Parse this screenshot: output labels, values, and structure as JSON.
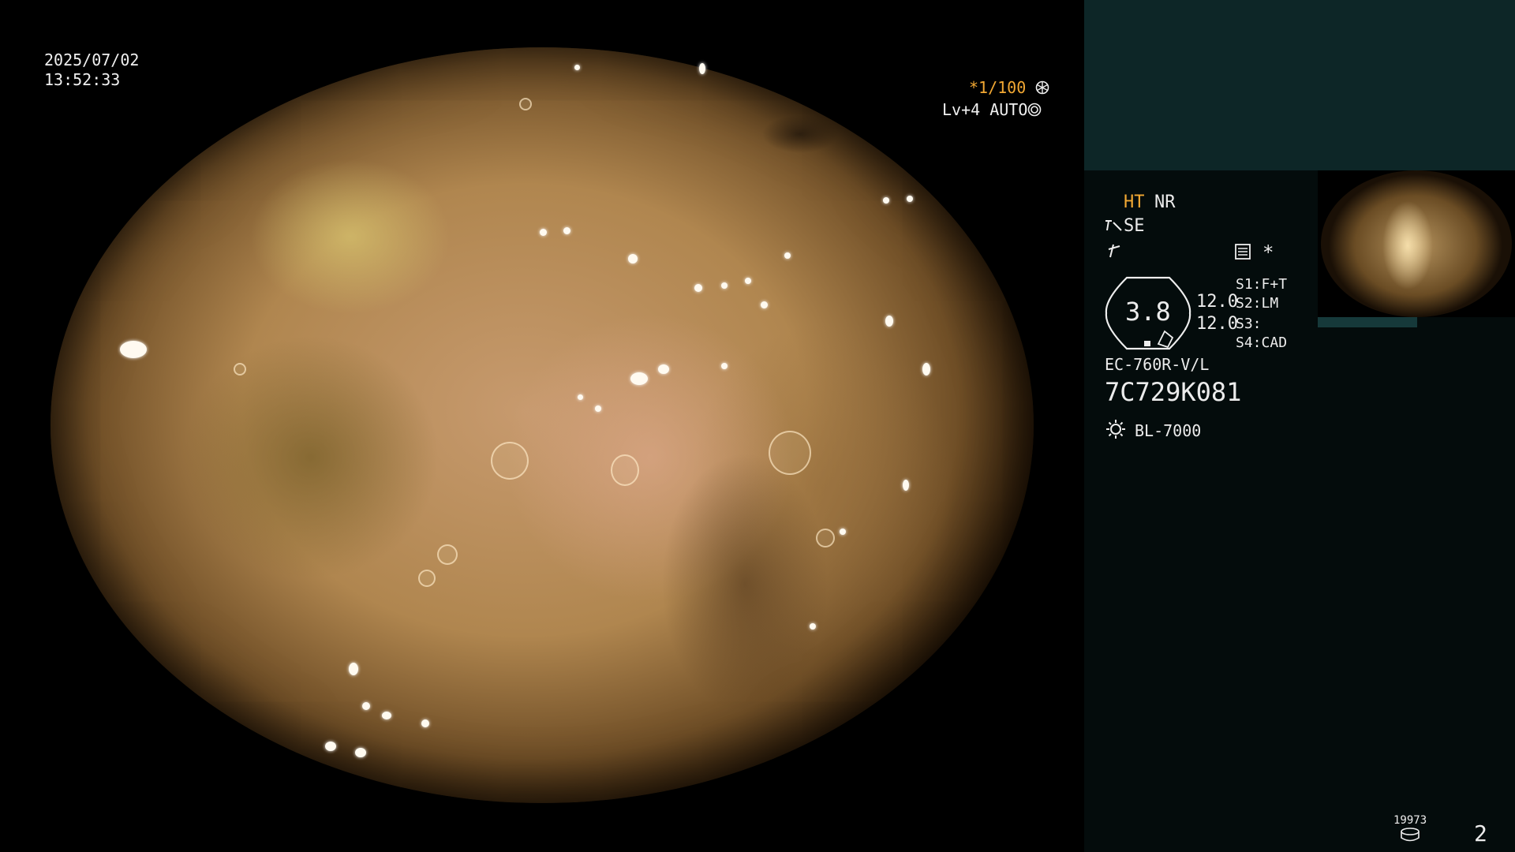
{
  "overlay": {
    "date": "2025/07/02",
    "time": "13:52:33",
    "shutter_prefix": "*",
    "shutter": "1/100",
    "shutter_icon": "shutter-icon",
    "level": "Lv+4",
    "exposure_mode": "AUTO",
    "exposure_icon": "exposure-icon"
  },
  "panel": {
    "modes": {
      "ht": "HT",
      "nr": "NR",
      "se": "SE"
    },
    "icons": [
      "structure-enhance-icon",
      "flash-icon",
      "settings-list-icon"
    ],
    "asterisk": "*",
    "zoom_value": "3.8",
    "values": [
      "12.0",
      "12.0"
    ],
    "switches": [
      {
        "key": "S1:",
        "value": "F+T"
      },
      {
        "key": "S2:",
        "value": "LM"
      },
      {
        "key": "S3:",
        "value": ""
      },
      {
        "key": "S4:",
        "value": "CAD"
      }
    ],
    "scope_model": "EC-760R-V/L",
    "scope_serial": "7C729K081",
    "light_source": "BL-7000",
    "light_icon": "light-source-icon",
    "image_count": "19973",
    "storage_icon": "storage-icon",
    "page_number": "2"
  },
  "colors": {
    "accent_orange": "#f2a833",
    "panel_top": "#0d2627",
    "panel_bg": "#040c0c"
  }
}
